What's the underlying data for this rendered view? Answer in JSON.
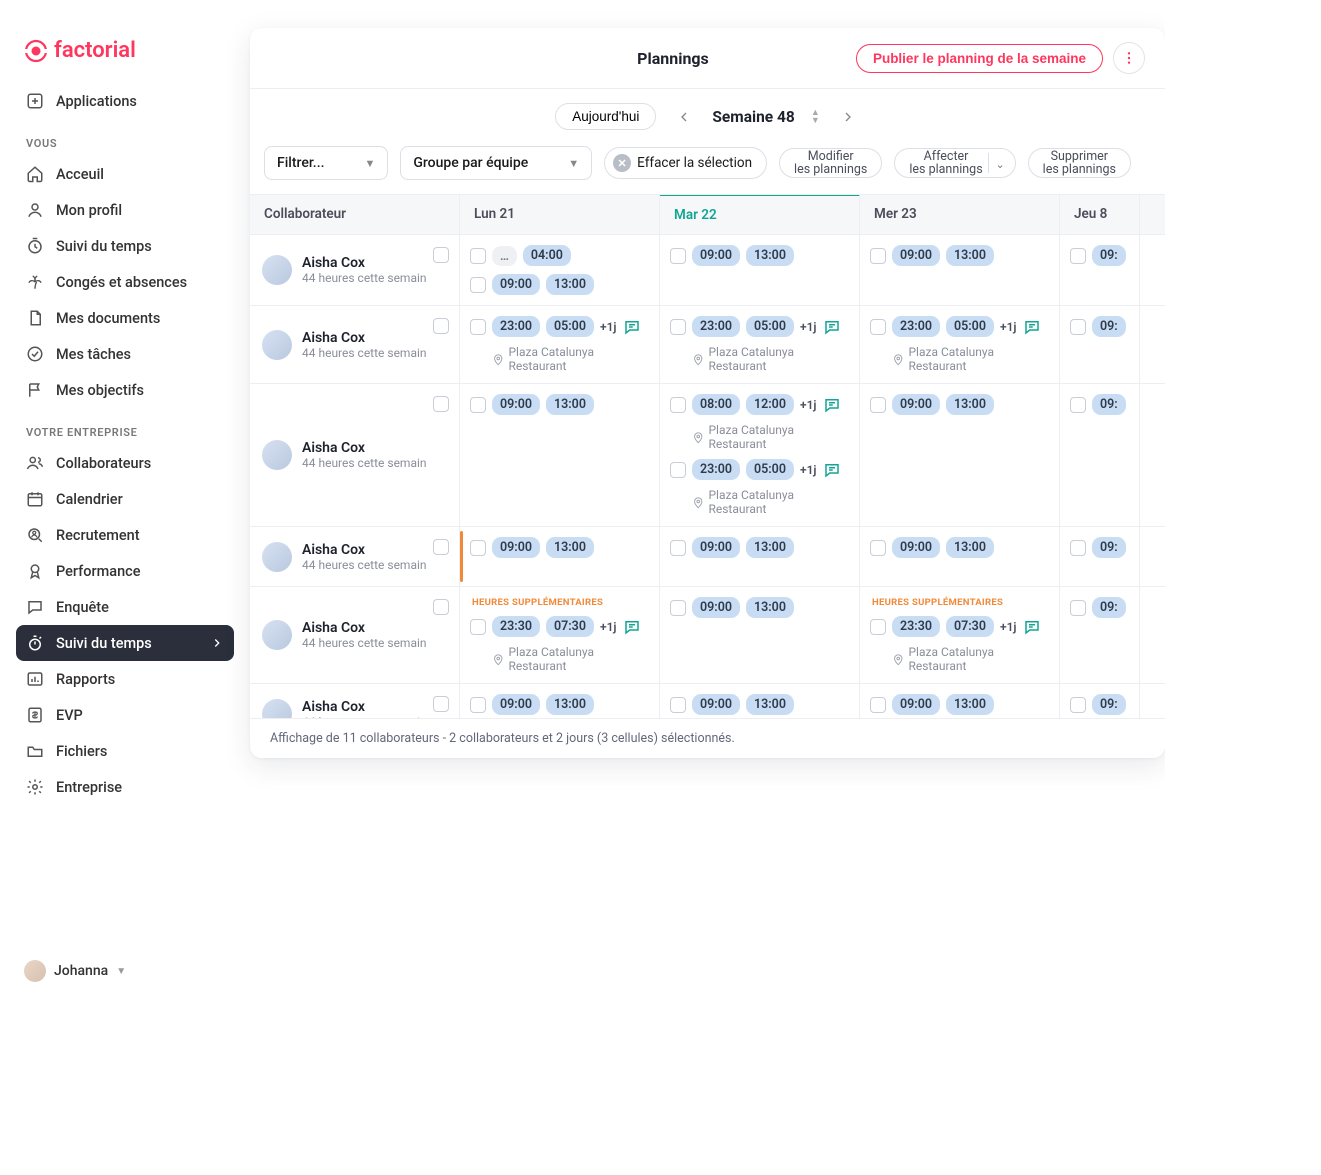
{
  "brand": "factorial",
  "sidebar": {
    "applications": "Applications",
    "sections": {
      "vous": "VOUS",
      "entreprise": "VOTRE ENTREPRISE"
    },
    "items": {
      "acceuil": "Acceuil",
      "profil": "Mon profil",
      "suivi": "Suivi du temps",
      "conges": "Congés et absences",
      "docs": "Mes documents",
      "taches": "Mes tâches",
      "objectifs": "Mes objectifs",
      "collab": "Collaborateurs",
      "calendrier": "Calendrier",
      "recrutement": "Recrutement",
      "performance": "Performance",
      "enquete": "Enquête",
      "suivi2": "Suivi du temps",
      "rapports": "Rapports",
      "evp": "EVP",
      "fichiers": "Fichiers",
      "entrepriseItem": "Entreprise"
    }
  },
  "user": {
    "name": "Johanna"
  },
  "header": {
    "title": "Plannings",
    "publish": "Publier le planning de la semaine"
  },
  "weeknav": {
    "today": "Aujourd'hui",
    "label": "Semaine 48"
  },
  "toolbar": {
    "filter": "Filtrer...",
    "group": "Groupe par équipe",
    "clear": "Effacer la sélection",
    "modify1": "Modifier",
    "modify2": "les plannings",
    "assign1": "Affecter",
    "assign2": "les plannings",
    "delete1": "Supprimer",
    "delete2": "les plannings"
  },
  "columns": {
    "collab": "Collaborateur",
    "d1": "Lun 21",
    "d2": "Mar 22",
    "d3": "Mer 23",
    "d4": "Jeu 8"
  },
  "labels": {
    "plusDay": "+1j",
    "location": "Plaza Catalunya Restaurant",
    "hs": "HEURES SUPPLÉMENTAIRES",
    "subweek": "44 heures cette semain"
  },
  "rows": [
    {
      "name": "Aisha Cox",
      "d1": [
        {
          "dots": true,
          "t2": "04:00"
        },
        {
          "t1": "09:00",
          "t2": "13:00"
        }
      ],
      "d2": [
        {
          "t1": "09:00",
          "t2": "13:00"
        }
      ],
      "d3": [
        {
          "t1": "09:00",
          "t2": "13:00"
        }
      ],
      "d4": [
        {
          "t1": "09:"
        }
      ]
    },
    {
      "name": "Aisha Cox",
      "d1": [
        {
          "t1": "23:00",
          "t2": "05:00",
          "plus": true,
          "comment": true,
          "loc": true
        }
      ],
      "d2": [
        {
          "t1": "23:00",
          "t2": "05:00",
          "plus": true,
          "comment": true,
          "loc": true
        }
      ],
      "d3": [
        {
          "t1": "23:00",
          "t2": "05:00",
          "plus": true,
          "comment": true,
          "loc": true
        }
      ],
      "d4": [
        {
          "t1": "09:"
        }
      ]
    },
    {
      "name": "Aisha Cox",
      "d1": [
        {
          "t1": "09:00",
          "t2": "13:00"
        }
      ],
      "d2": [
        {
          "t1": "08:00",
          "t2": "12:00",
          "plus": true,
          "comment": true,
          "loc": true
        },
        {
          "t1": "23:00",
          "t2": "05:00",
          "plus": true,
          "comment": true,
          "loc": true
        }
      ],
      "d3": [
        {
          "t1": "09:00",
          "t2": "13:00"
        }
      ],
      "d4": [
        {
          "t1": "09:"
        }
      ]
    },
    {
      "name": "Aisha Cox",
      "d1": [
        {
          "t1": "09:00",
          "t2": "13:00",
          "orange": true
        }
      ],
      "d2": [
        {
          "t1": "09:00",
          "t2": "13:00"
        }
      ],
      "d3": [
        {
          "t1": "09:00",
          "t2": "13:00"
        }
      ],
      "d4": [
        {
          "t1": "09:"
        }
      ]
    },
    {
      "name": "Aisha Cox",
      "d1": [
        {
          "hs": true,
          "t1": "23:30",
          "t2": "07:30",
          "plus": true,
          "comment": true,
          "loc": true
        }
      ],
      "d2": [
        {
          "t1": "09:00",
          "t2": "13:00"
        }
      ],
      "d3": [
        {
          "hs": true,
          "t1": "23:30",
          "t2": "07:30",
          "plus": true,
          "comment": true,
          "loc": true
        }
      ],
      "d4": [
        {
          "t1": "09:"
        }
      ]
    },
    {
      "name": "Aisha Cox",
      "d1": [
        {
          "t1": "09:00",
          "t2": "13:00"
        }
      ],
      "d2": [
        {
          "t1": "09:00",
          "t2": "13:00"
        }
      ],
      "d3": [
        {
          "t1": "09:00",
          "t2": "13:00"
        }
      ],
      "d4": [
        {
          "t1": "09:"
        }
      ]
    }
  ],
  "footer": "Affichage de 11 collaborateurs - 2 collaborateurs et 2 jours (3 cellules) sélectionnés."
}
